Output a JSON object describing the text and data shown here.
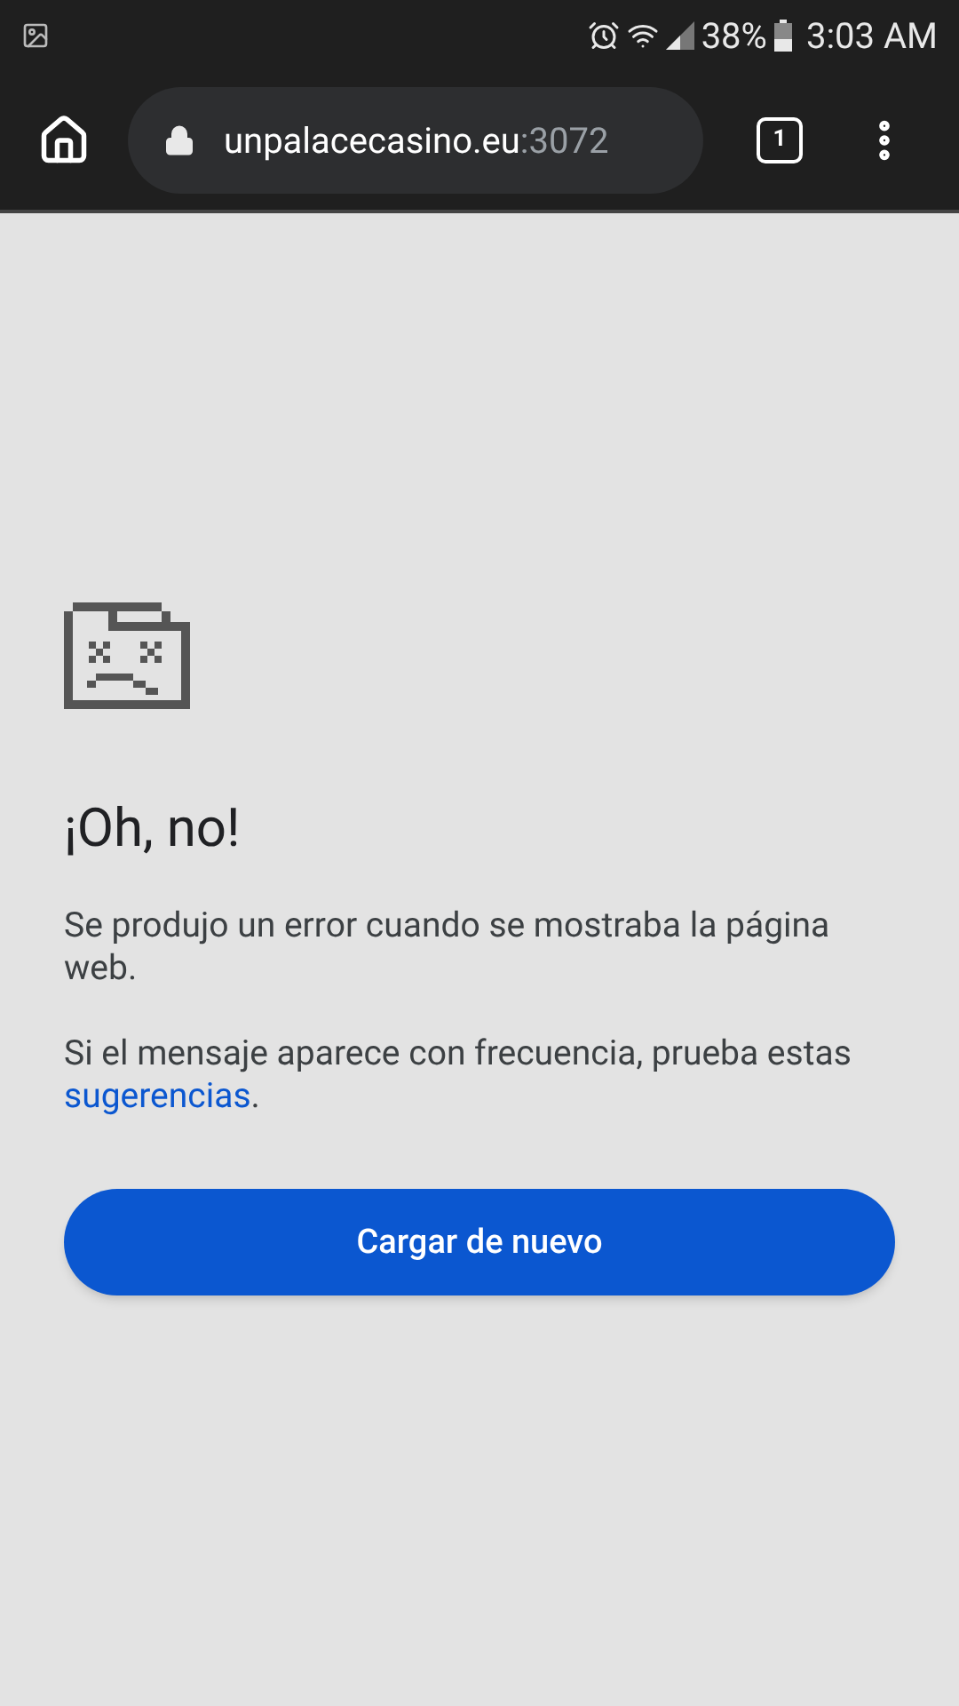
{
  "status_bar": {
    "battery": "38%",
    "time": "3:03 AM"
  },
  "toolbar": {
    "host": "unpalacecasino.eu",
    "port": ":3072",
    "tab_count": "1"
  },
  "error": {
    "title": "¡Oh, no!",
    "message": "Se produjo un error cuando se mostraba la página web.",
    "hint_before": "Si el mensaje aparece con frecuencia, prueba estas ",
    "hint_link": "sugerencias",
    "hint_after": ".",
    "button": "Cargar de nuevo"
  }
}
